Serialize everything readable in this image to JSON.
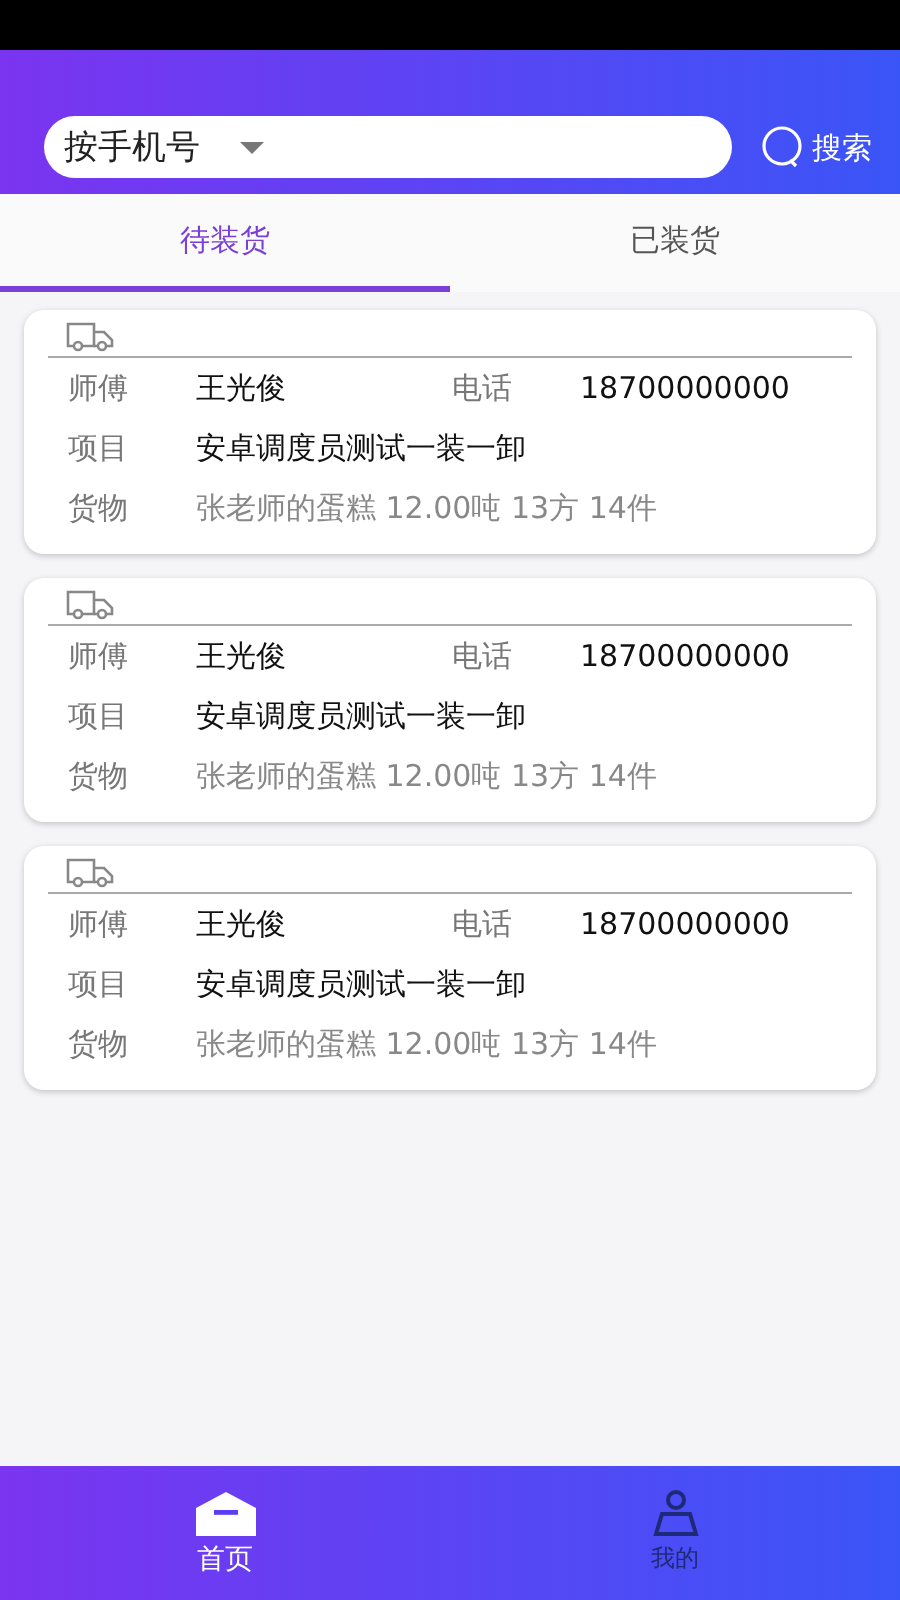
{
  "search": {
    "filter": "按手机号",
    "button": "搜索"
  },
  "tabs": [
    {
      "label": "待装货",
      "selected": true
    },
    {
      "label": "已装货",
      "selected": false
    }
  ],
  "orders": [
    {
      "driver_label": "师傅",
      "driver": "王光俊",
      "phone_label": "电话",
      "phone": "18700000000",
      "project_label": "项目",
      "project": "安卓调度员测试一装一卸",
      "goods_label": "货物",
      "goods": "张老师的蛋糕 12.00吨 13方 14件"
    },
    {
      "driver_label": "师傅",
      "driver": "王光俊",
      "phone_label": "电话",
      "phone": "18700000000",
      "project_label": "项目",
      "project": "安卓调度员测试一装一卸",
      "goods_label": "货物",
      "goods": "张老师的蛋糕 12.00吨 13方 14件"
    },
    {
      "driver_label": "师傅",
      "driver": "王光俊",
      "phone_label": "电话",
      "phone": "18700000000",
      "project_label": "项目",
      "project": "安卓调度员测试一装一卸",
      "goods_label": "货物",
      "goods": "张老师的蛋糕 12.00吨 13方 14件"
    }
  ],
  "nav": [
    {
      "kind": "home",
      "label": "首页",
      "selected": true
    },
    {
      "kind": "profile",
      "label": "我的",
      "selected": false
    }
  ]
}
